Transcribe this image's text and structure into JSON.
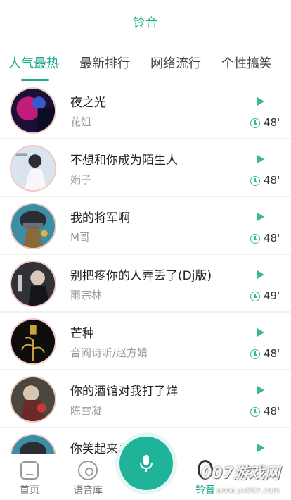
{
  "header": {
    "title": "铃音"
  },
  "tabs": [
    {
      "label": "人气最热",
      "active": true
    },
    {
      "label": "最新排行",
      "active": false
    },
    {
      "label": "网络流行",
      "active": false
    },
    {
      "label": "个性搞笑",
      "active": false
    }
  ],
  "songs": [
    {
      "title": "夜之光",
      "artist": "花姐",
      "duration": "48'"
    },
    {
      "title": "不想和你成为陌生人",
      "artist": "娟子",
      "duration": "48'"
    },
    {
      "title": "我的将军啊",
      "artist": "M哥",
      "duration": "48'"
    },
    {
      "title": "别把疼你的人弄丢了(Dj版)",
      "artist": "雨宗林",
      "duration": "49'"
    },
    {
      "title": "芒种",
      "artist": "音阙诗听/赵方婧",
      "duration": "48'"
    },
    {
      "title": "你的酒馆对我打了烊",
      "artist": "陈雪凝",
      "duration": "48'"
    },
    {
      "title": "你笑起来真好看",
      "artist": "",
      "duration": ""
    }
  ],
  "bottom_nav": {
    "home": "首页",
    "voice_library": "语音库",
    "ringtone": "铃音"
  },
  "watermark": {
    "main": "007游戏网",
    "sub": "www.yx007.com"
  },
  "colors": {
    "accent": "#1fa98c",
    "play": "#3bb896",
    "list_bg": "#f0f0f0"
  },
  "icons": {
    "play": "play-triangle-icon",
    "duration": "clock-icon",
    "home": "home-icon",
    "voice_library": "disc-icon",
    "mic": "microphone-icon",
    "ringtone": "ringtone-icon"
  }
}
